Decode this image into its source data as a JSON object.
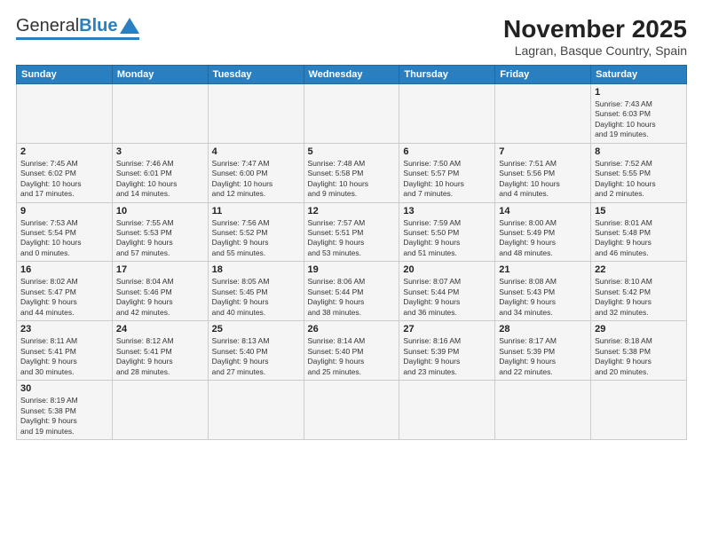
{
  "header": {
    "logo_general": "General",
    "logo_blue": "Blue",
    "month_title": "November 2025",
    "location": "Lagran, Basque Country, Spain"
  },
  "days_of_week": [
    "Sunday",
    "Monday",
    "Tuesday",
    "Wednesday",
    "Thursday",
    "Friday",
    "Saturday"
  ],
  "weeks": [
    {
      "days": [
        {
          "number": "",
          "info": ""
        },
        {
          "number": "",
          "info": ""
        },
        {
          "number": "",
          "info": ""
        },
        {
          "number": "",
          "info": ""
        },
        {
          "number": "",
          "info": ""
        },
        {
          "number": "",
          "info": ""
        },
        {
          "number": "1",
          "info": "Sunrise: 7:43 AM\nSunset: 6:03 PM\nDaylight: 10 hours\nand 19 minutes."
        }
      ]
    },
    {
      "days": [
        {
          "number": "2",
          "info": "Sunrise: 7:45 AM\nSunset: 6:02 PM\nDaylight: 10 hours\nand 17 minutes."
        },
        {
          "number": "3",
          "info": "Sunrise: 7:46 AM\nSunset: 6:01 PM\nDaylight: 10 hours\nand 14 minutes."
        },
        {
          "number": "4",
          "info": "Sunrise: 7:47 AM\nSunset: 6:00 PM\nDaylight: 10 hours\nand 12 minutes."
        },
        {
          "number": "5",
          "info": "Sunrise: 7:48 AM\nSunset: 5:58 PM\nDaylight: 10 hours\nand 9 minutes."
        },
        {
          "number": "6",
          "info": "Sunrise: 7:50 AM\nSunset: 5:57 PM\nDaylight: 10 hours\nand 7 minutes."
        },
        {
          "number": "7",
          "info": "Sunrise: 7:51 AM\nSunset: 5:56 PM\nDaylight: 10 hours\nand 4 minutes."
        },
        {
          "number": "8",
          "info": "Sunrise: 7:52 AM\nSunset: 5:55 PM\nDaylight: 10 hours\nand 2 minutes."
        }
      ]
    },
    {
      "days": [
        {
          "number": "9",
          "info": "Sunrise: 7:53 AM\nSunset: 5:54 PM\nDaylight: 10 hours\nand 0 minutes."
        },
        {
          "number": "10",
          "info": "Sunrise: 7:55 AM\nSunset: 5:53 PM\nDaylight: 9 hours\nand 57 minutes."
        },
        {
          "number": "11",
          "info": "Sunrise: 7:56 AM\nSunset: 5:52 PM\nDaylight: 9 hours\nand 55 minutes."
        },
        {
          "number": "12",
          "info": "Sunrise: 7:57 AM\nSunset: 5:51 PM\nDaylight: 9 hours\nand 53 minutes."
        },
        {
          "number": "13",
          "info": "Sunrise: 7:59 AM\nSunset: 5:50 PM\nDaylight: 9 hours\nand 51 minutes."
        },
        {
          "number": "14",
          "info": "Sunrise: 8:00 AM\nSunset: 5:49 PM\nDaylight: 9 hours\nand 48 minutes."
        },
        {
          "number": "15",
          "info": "Sunrise: 8:01 AM\nSunset: 5:48 PM\nDaylight: 9 hours\nand 46 minutes."
        }
      ]
    },
    {
      "days": [
        {
          "number": "16",
          "info": "Sunrise: 8:02 AM\nSunset: 5:47 PM\nDaylight: 9 hours\nand 44 minutes."
        },
        {
          "number": "17",
          "info": "Sunrise: 8:04 AM\nSunset: 5:46 PM\nDaylight: 9 hours\nand 42 minutes."
        },
        {
          "number": "18",
          "info": "Sunrise: 8:05 AM\nSunset: 5:45 PM\nDaylight: 9 hours\nand 40 minutes."
        },
        {
          "number": "19",
          "info": "Sunrise: 8:06 AM\nSunset: 5:44 PM\nDaylight: 9 hours\nand 38 minutes."
        },
        {
          "number": "20",
          "info": "Sunrise: 8:07 AM\nSunset: 5:44 PM\nDaylight: 9 hours\nand 36 minutes."
        },
        {
          "number": "21",
          "info": "Sunrise: 8:08 AM\nSunset: 5:43 PM\nDaylight: 9 hours\nand 34 minutes."
        },
        {
          "number": "22",
          "info": "Sunrise: 8:10 AM\nSunset: 5:42 PM\nDaylight: 9 hours\nand 32 minutes."
        }
      ]
    },
    {
      "days": [
        {
          "number": "23",
          "info": "Sunrise: 8:11 AM\nSunset: 5:41 PM\nDaylight: 9 hours\nand 30 minutes."
        },
        {
          "number": "24",
          "info": "Sunrise: 8:12 AM\nSunset: 5:41 PM\nDaylight: 9 hours\nand 28 minutes."
        },
        {
          "number": "25",
          "info": "Sunrise: 8:13 AM\nSunset: 5:40 PM\nDaylight: 9 hours\nand 27 minutes."
        },
        {
          "number": "26",
          "info": "Sunrise: 8:14 AM\nSunset: 5:40 PM\nDaylight: 9 hours\nand 25 minutes."
        },
        {
          "number": "27",
          "info": "Sunrise: 8:16 AM\nSunset: 5:39 PM\nDaylight: 9 hours\nand 23 minutes."
        },
        {
          "number": "28",
          "info": "Sunrise: 8:17 AM\nSunset: 5:39 PM\nDaylight: 9 hours\nand 22 minutes."
        },
        {
          "number": "29",
          "info": "Sunrise: 8:18 AM\nSunset: 5:38 PM\nDaylight: 9 hours\nand 20 minutes."
        }
      ]
    },
    {
      "days": [
        {
          "number": "30",
          "info": "Sunrise: 8:19 AM\nSunset: 5:38 PM\nDaylight: 9 hours\nand 19 minutes."
        },
        {
          "number": "",
          "info": ""
        },
        {
          "number": "",
          "info": ""
        },
        {
          "number": "",
          "info": ""
        },
        {
          "number": "",
          "info": ""
        },
        {
          "number": "",
          "info": ""
        },
        {
          "number": "",
          "info": ""
        }
      ]
    }
  ]
}
